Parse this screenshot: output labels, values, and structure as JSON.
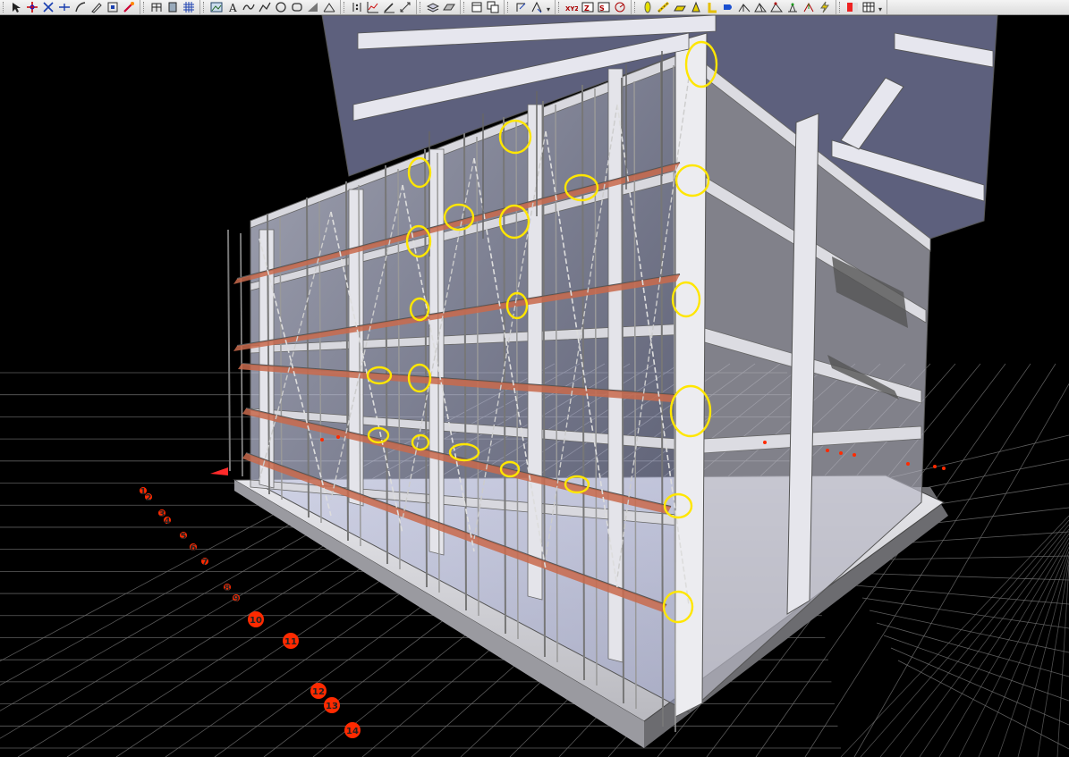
{
  "toolbar": {
    "groups": [
      [
        "pointer-icon",
        "snap-icon",
        "cross-icon",
        "line-split-icon",
        "arc-icon",
        "edit-icon",
        "view-icon",
        "wand-icon"
      ],
      [
        "frame-icon",
        "panel-icon",
        "grid-icon"
      ],
      [
        "picture-icon",
        "text-icon",
        "curve-icon",
        "polyline-icon",
        "circle-icon",
        "rectangle-icon",
        "ramp-icon",
        "measure-icon"
      ],
      [
        "point-cloud-icon",
        "chart-icon",
        "draw-icon",
        "dimension-icon"
      ],
      [
        "layers-icon",
        "plane-icon"
      ],
      [
        "window-icon",
        "copy-window-icon"
      ],
      [
        "transform-icon",
        "offset-icon"
      ],
      [
        "xyz-icon",
        "z-elevation-icon",
        "section-icon",
        "rotate-icon"
      ],
      [
        "column-icon",
        "beam-icon",
        "slab-icon",
        "stair-icon",
        "wall-icon",
        "footing-icon",
        "roof-icon",
        "truss-icon",
        "stairs-node-icon",
        "support-icon",
        "load-icon",
        "lightning-icon"
      ],
      [
        "color-icon",
        "table-icon"
      ]
    ]
  },
  "model": {
    "colors": {
      "background": "#000000",
      "grid": "#6e6e6e",
      "marker": "#ffe600",
      "axis_label": "#ff2a00",
      "plank": "#c96a4c"
    },
    "axis_labels": [
      "1",
      "2",
      "3",
      "4",
      "5",
      "6",
      "7",
      "8",
      "9",
      "10",
      "11",
      "12",
      "13",
      "14"
    ],
    "highlight_count": 25
  }
}
